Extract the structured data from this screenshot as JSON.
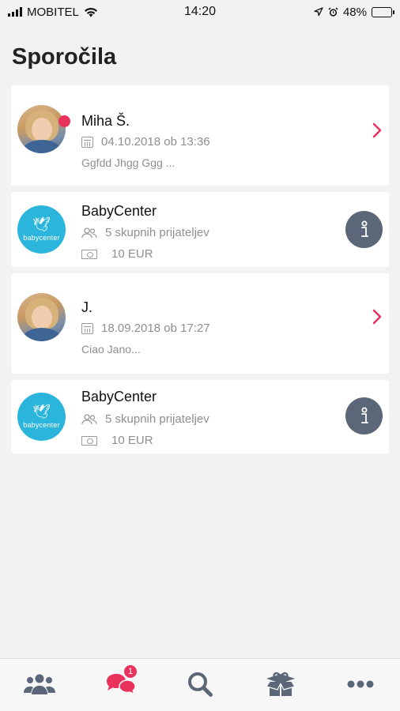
{
  "status_bar": {
    "carrier": "MOBITEL",
    "time": "14:20",
    "battery": "48%",
    "battery_level": 0.48
  },
  "page": {
    "title": "Sporočila"
  },
  "conversations": [
    {
      "type": "person",
      "name": "Miha Š.",
      "date": "04.10.2018 ob 13:36",
      "preview": "Ggfdd Jhgg Ggg ...",
      "unread": true,
      "action_icon": "chevron-right-icon"
    },
    {
      "type": "brand",
      "name": "BabyCenter",
      "avatar_text": "babycenter",
      "friends": "5 skupnih prijateljev",
      "price": "10 EUR",
      "action_icon": "info-icon"
    },
    {
      "type": "person",
      "name": "J.",
      "date": "18.09.2018 ob 17:27",
      "preview": "Ciao Jano...",
      "unread": false,
      "action_icon": "chevron-right-icon"
    },
    {
      "type": "brand",
      "name": "BabyCenter",
      "avatar_text": "babycenter",
      "friends": "5 skupnih prijateljev",
      "price": "10 EUR",
      "action_icon": "info-icon"
    }
  ],
  "tab_bar": {
    "tabs": [
      {
        "icon": "people-icon",
        "active": false
      },
      {
        "icon": "chat-icon",
        "active": true,
        "badge": "1"
      },
      {
        "icon": "search-icon",
        "active": false
      },
      {
        "icon": "gift-box-icon",
        "active": false
      },
      {
        "icon": "more-icon",
        "active": false
      }
    ]
  },
  "colors": {
    "accent": "#e8315b",
    "icon_gray": "#5b6778",
    "brand_blue": "#2bb5dc",
    "background": "#f2f2f4"
  }
}
